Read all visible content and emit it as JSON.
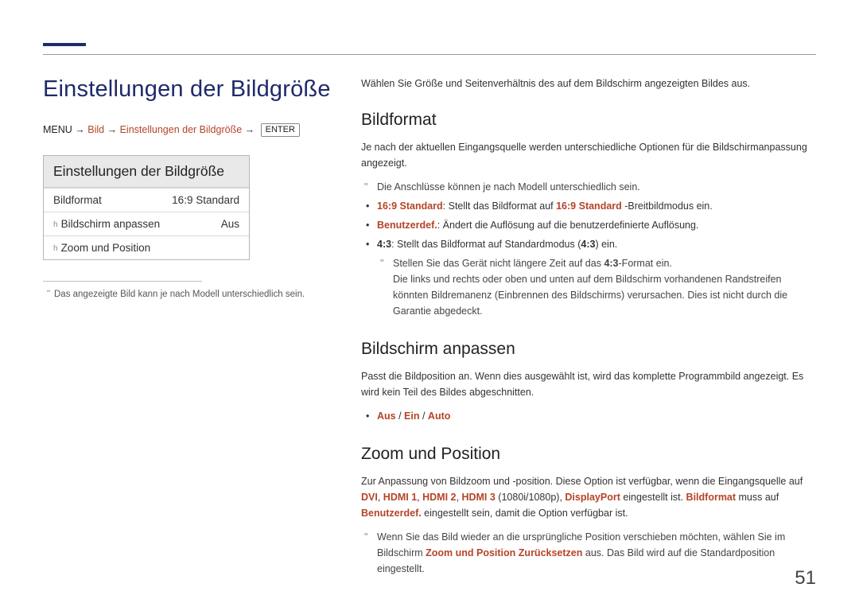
{
  "page_number": "51",
  "left": {
    "title": "Einstellungen der Bildgröße",
    "breadcrumb": {
      "menu": "MENU",
      "arrow": "→",
      "bild": "Bild",
      "einstellungen": "Einstellungen der Bildgröße",
      "enter": "ENTER"
    },
    "menu_box": {
      "title": "Einstellungen der Bildgröße",
      "rows": [
        {
          "label": "Bildformat",
          "value": "16:9 Standard",
          "locked": false
        },
        {
          "label": "Bildschirm anpassen",
          "value": "Aus",
          "locked": true
        },
        {
          "label": "Zoom und Position",
          "value": "",
          "locked": true
        }
      ]
    },
    "footnote": "Das angezeigte Bild kann je nach Modell unterschiedlich sein."
  },
  "right": {
    "intro": "Wählen Sie Größe und Seitenverhältnis des auf dem Bildschirm angezeigten Bildes aus.",
    "bildformat": {
      "title": "Bildformat",
      "para": "Je nach der aktuellen Eingangsquelle werden unterschiedliche Optionen für die Bildschirmanpassung angezeigt.",
      "note1": "Die Anschlüsse können je nach Modell unterschiedlich sein.",
      "b1_pre": "16:9 Standard",
      "b1_post": ": Stellt das Bildformat auf ",
      "b1_mid": "16:9 Standard",
      "b1_end": " -Breitbildmodus ein.",
      "b2_pre": "Benutzerdef.",
      "b2_post": ": Ändert die Auflösung auf die benutzerdefinierte Auflösung.",
      "b3_pre": "4:3",
      "b3_mid": ": Stellt das Bildformat auf Standardmodus (",
      "b3_accent": "4:3",
      "b3_end": ") ein.",
      "sub_q1_a": "Stellen Sie das Gerät nicht längere Zeit auf das ",
      "sub_q1_accent": "4:3",
      "sub_q1_b": "-Format ein.",
      "sub_q1_c": "Die links und rechts oder oben und unten auf dem Bildschirm vorhandenen Randstreifen könnten Bildremanenz (Einbrennen des Bildschirms) verursachen. Dies ist nicht durch die Garantie abgedeckt."
    },
    "bildschirm": {
      "title": "Bildschirm anpassen",
      "para": "Passt die Bildposition an. Wenn dies ausgewählt ist, wird das komplette Programmbild angezeigt. Es wird kein Teil des Bildes abgeschnitten.",
      "opts_aus": "Aus",
      "opts_ein": "Ein",
      "opts_auto": "Auto",
      "sep": " / "
    },
    "zoom": {
      "title": "Zoom und Position",
      "p_a": "Zur Anpassung von Bildzoom und -position. Diese Option ist verfügbar, wenn die Eingangsquelle auf ",
      "dvi": "DVI",
      "comma": ", ",
      "hdmi1": "HDMI 1",
      "hdmi2": "HDMI 2",
      "hdmi3": "HDMI 3",
      "res": " (1080i/1080p), ",
      "dp": "DisplayPort",
      "p_b": " eingestellt ist. ",
      "bf": "Bildformat",
      "p_c": " muss auf ",
      "ben": "Benutzerdef.",
      "p_d": " eingestellt sein, damit die Option verfügbar ist.",
      "q_a": "Wenn Sie das Bild wieder an die ursprüngliche Position verschieben möchten, wählen Sie im Bildschirm ",
      "q_accent": "Zoom und Position",
      "q_accent2": "Zurücksetzen",
      "q_b": " aus. Das Bild wird auf die Standardposition eingestellt."
    }
  }
}
